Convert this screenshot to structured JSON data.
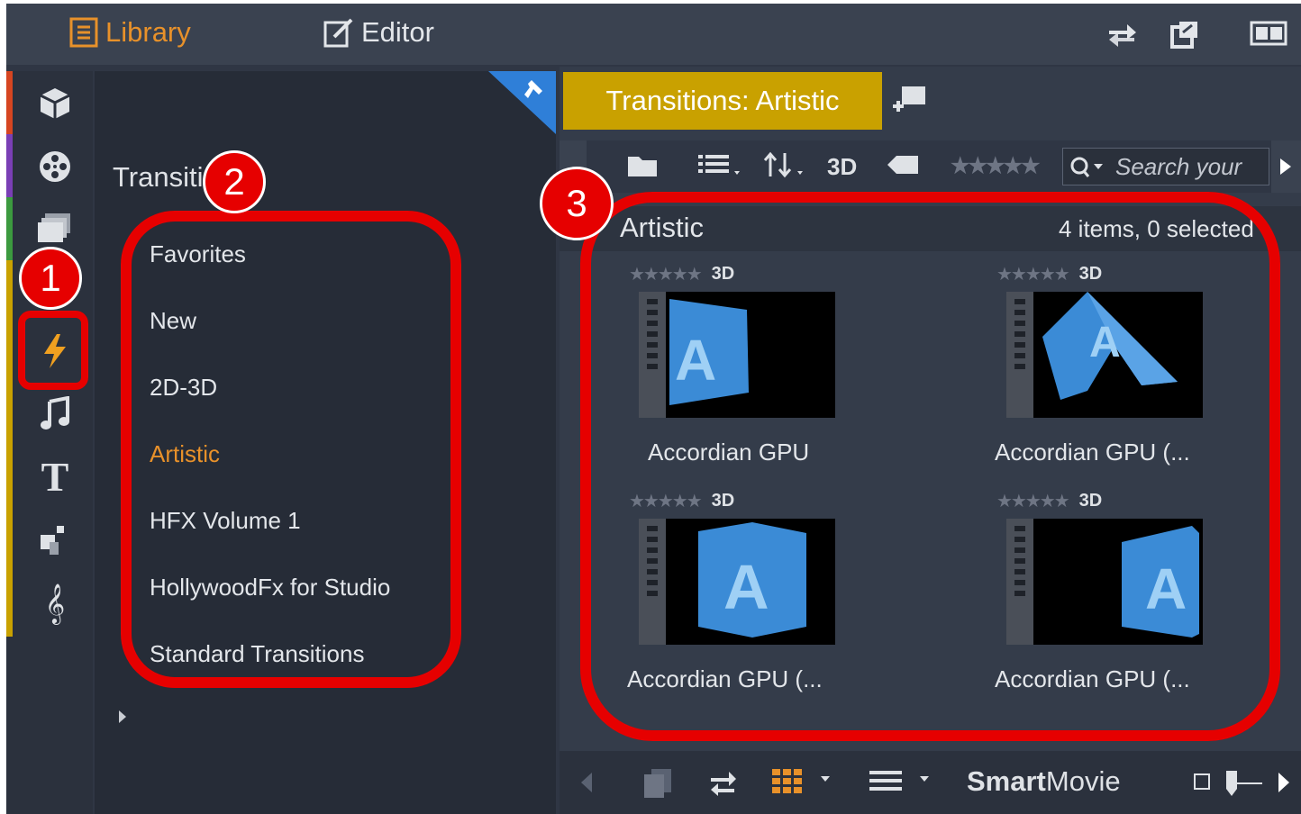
{
  "topbar": {
    "library_label": "Library",
    "editor_label": "Editor",
    "icons": [
      "swap-icon",
      "popout-icon",
      "layout-icon"
    ]
  },
  "rail": {
    "items": [
      "packages-icon",
      "movie-reel-icon",
      "folders-icon",
      "transitions-icon",
      "music-icon",
      "titles-icon",
      "montage-icon",
      "score-icon"
    ]
  },
  "categories": {
    "title": "Transiti",
    "items": [
      {
        "label": "Favorites"
      },
      {
        "label": "New"
      },
      {
        "label": "2D-3D"
      },
      {
        "label": "Artistic",
        "active": true
      },
      {
        "label": "HFX Volume 1"
      },
      {
        "label": "HollywoodFx for Studio"
      },
      {
        "label": "Standard Transitions"
      }
    ]
  },
  "content": {
    "tab_label": "Transitions: Artistic",
    "toolbar": {
      "badge_3d": "3D",
      "search_placeholder": "Search your"
    },
    "list_title": "Artistic",
    "list_count": "4 items, 0 selected",
    "items": [
      {
        "label": "Accordian GPU",
        "badge": "3D",
        "stars": "★★★★★"
      },
      {
        "label": "Accordian GPU (...",
        "badge": "3D",
        "stars": "★★★★★"
      },
      {
        "label": "Accordian GPU (...",
        "badge": "3D",
        "stars": "★★★★★"
      },
      {
        "label": "Accordian GPU (...",
        "badge": "3D",
        "stars": "★★★★★"
      }
    ],
    "bottombar": {
      "smart": "Smart",
      "movie": "Movie"
    }
  },
  "annotations": [
    "1",
    "2",
    "3"
  ],
  "colors": {
    "accent_orange": "#e8912a",
    "tab_gold": "#c9a100",
    "annotation_red": "#e60000"
  }
}
